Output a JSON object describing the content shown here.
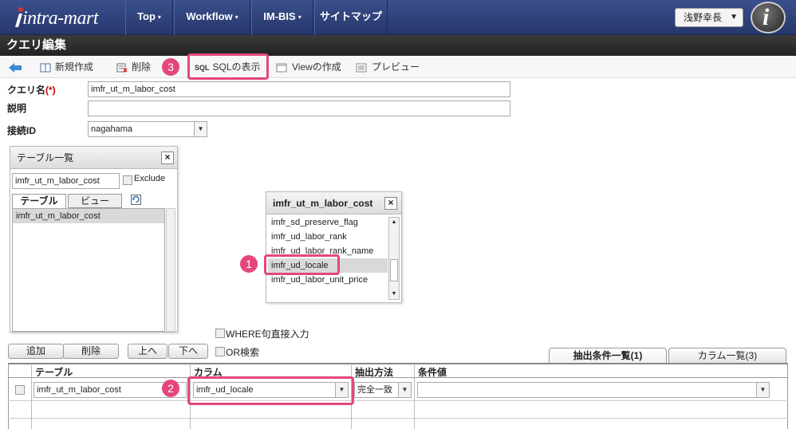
{
  "nav": {
    "logo": "intra-mart",
    "items": [
      {
        "label": "Top",
        "caret": "▾"
      },
      {
        "label": "Workflow",
        "caret": "▾"
      },
      {
        "label": "IM-BIS",
        "caret": "▾"
      },
      {
        "label": "サイトマップ",
        "caret": ""
      }
    ],
    "user": "浅野幸長",
    "avatar_letter": "i"
  },
  "page_title": "クエリ編集",
  "toolbar": {
    "new": "新規作成",
    "delete": "削除",
    "sql_icon": "SQL",
    "show_sql": "SQLの表示",
    "create_view": "Viewの作成",
    "preview": "プレビュー"
  },
  "form": {
    "query_name_label": "クエリ名",
    "required_mark": "(*)",
    "query_name_value": "imfr_ut_m_labor_cost",
    "description_label": "説明",
    "description_value": "",
    "connection_label": "接続ID",
    "connection_value": "nagahama"
  },
  "table_list": {
    "title": "テーブル一覧",
    "search_value": "imfr_ut_m_labor_cost",
    "exclude_label": "Exclude",
    "tab_table": "テーブル",
    "tab_view": "ビュー",
    "items": [
      "imfr_ut_m_labor_cost"
    ]
  },
  "column_panel": {
    "title": "imfr_ut_m_labor_cost",
    "columns": [
      "imfr_sd_preserve_flag",
      "imfr_ud_labor_rank",
      "imfr_ud_labor_rank_name",
      "imfr_ud_locale",
      "imfr_ud_labor_unit_price"
    ]
  },
  "options": {
    "where_direct": "WHERE句直接入力",
    "or_search": "OR検索"
  },
  "buttons": {
    "add": "追加",
    "remove": "削除",
    "up": "上へ",
    "down": "下へ"
  },
  "right_tabs": {
    "conditions": "抽出条件一覧(1)",
    "columns": "カラム一覧(3)"
  },
  "grid": {
    "headers": [
      "テーブル",
      "カラム",
      "抽出方法",
      "条件値"
    ],
    "rows": [
      {
        "table": "imfr_ut_m_labor_cost",
        "column": "imfr_ud_locale",
        "method": "完全一致",
        "value": ""
      }
    ]
  },
  "badges": {
    "one": "1",
    "two": "2",
    "three": "3"
  },
  "colors": {
    "accent": "#e4477a",
    "nav_bg": "#2e427a",
    "title_bg": "#2b2b2b"
  }
}
